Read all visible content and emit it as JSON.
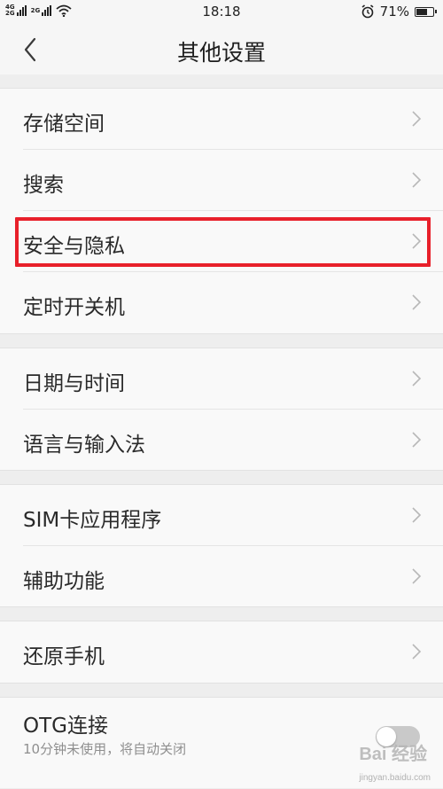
{
  "status_bar": {
    "sim1_top": "4G",
    "sim1_bottom": "2G",
    "sim2_tag": "2G",
    "time": "18:18",
    "battery": "71%",
    "battery_level": 0.71
  },
  "header": {
    "title": "其他设置"
  },
  "groups": [
    {
      "items": [
        {
          "label": "存储空间"
        },
        {
          "label": "搜索"
        },
        {
          "label": "安全与隐私"
        },
        {
          "label": "定时开关机"
        }
      ]
    },
    {
      "items": [
        {
          "label": "日期与时间"
        },
        {
          "label": "语言与输入法"
        }
      ]
    },
    {
      "items": [
        {
          "label": "SIM卡应用程序"
        },
        {
          "label": "辅助功能"
        }
      ]
    },
    {
      "items": [
        {
          "label": "还原手机"
        }
      ]
    }
  ],
  "otg": {
    "label": "OTG连接",
    "subtitle": "10分钟未使用，将自动关闭",
    "enabled": false
  },
  "watermark": {
    "text": "Bai 经验",
    "url": "jingyan.baidu.com"
  },
  "colors": {
    "highlight": "#e8202a"
  }
}
